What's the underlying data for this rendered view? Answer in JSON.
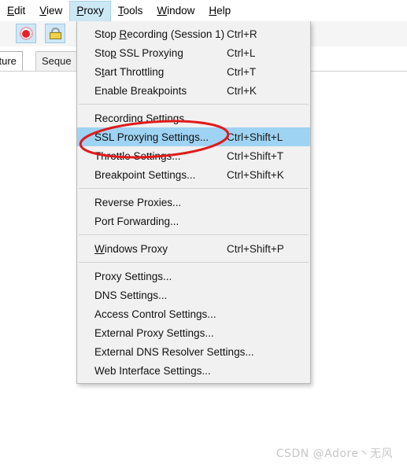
{
  "window": {
    "menubar": {
      "items": [
        {
          "label": "Edit",
          "mnemonic": "E",
          "active": false
        },
        {
          "label": "View",
          "mnemonic": "V",
          "active": false
        },
        {
          "label": "Proxy",
          "mnemonic": "P",
          "active": true
        },
        {
          "label": "Tools",
          "mnemonic": "T",
          "active": false
        },
        {
          "label": "Window",
          "mnemonic": "W",
          "active": false
        },
        {
          "label": "Help",
          "mnemonic": "H",
          "active": false
        }
      ]
    },
    "toolbar": {
      "buttons": [
        {
          "name": "record-button",
          "icon": "record-circle-icon",
          "pressed": true
        },
        {
          "name": "ssl-proxying-button",
          "icon": "padlock-icon",
          "pressed": true
        }
      ]
    },
    "tabs": [
      {
        "label": "cture",
        "full_label": "Structure",
        "selected": true
      },
      {
        "label": "Seque",
        "full_label": "Sequence",
        "selected": false
      }
    ]
  },
  "proxy_menu": {
    "title": "Proxy",
    "selected_item": "SSL Proxying Settings...",
    "highlight_color": "#9fd3f3",
    "items": [
      {
        "type": "item",
        "label": "Stop Recording (Session 1)",
        "mnemonic": "R",
        "accel": "Ctrl+R"
      },
      {
        "type": "item",
        "label": "Stop SSL Proxying",
        "mnemonic": "p",
        "accel": "Ctrl+L"
      },
      {
        "type": "item",
        "label": "Start Throttling",
        "mnemonic": "t",
        "accel": "Ctrl+T"
      },
      {
        "type": "item",
        "label": "Enable Breakpoints",
        "mnemonic": "",
        "accel": "Ctrl+K"
      },
      {
        "type": "separator"
      },
      {
        "type": "item",
        "label": "Recording Settings...",
        "mnemonic": "",
        "accel": ""
      },
      {
        "type": "item",
        "label": "SSL Proxying Settings...",
        "mnemonic": "",
        "accel": "Ctrl+Shift+L",
        "selected": true
      },
      {
        "type": "item",
        "label": "Throttle Settings...",
        "mnemonic": "",
        "accel": "Ctrl+Shift+T"
      },
      {
        "type": "item",
        "label": "Breakpoint Settings...",
        "mnemonic": "",
        "accel": "Ctrl+Shift+K"
      },
      {
        "type": "separator"
      },
      {
        "type": "item",
        "label": "Reverse Proxies...",
        "mnemonic": "",
        "accel": ""
      },
      {
        "type": "item",
        "label": "Port Forwarding...",
        "mnemonic": "",
        "accel": ""
      },
      {
        "type": "separator"
      },
      {
        "type": "item",
        "label": "Windows Proxy",
        "mnemonic": "W",
        "accel": "Ctrl+Shift+P"
      },
      {
        "type": "separator"
      },
      {
        "type": "item",
        "label": "Proxy Settings...",
        "mnemonic": "",
        "accel": ""
      },
      {
        "type": "item",
        "label": "DNS Settings...",
        "mnemonic": "",
        "accel": ""
      },
      {
        "type": "item",
        "label": "Access Control Settings...",
        "mnemonic": "",
        "accel": ""
      },
      {
        "type": "item",
        "label": "External Proxy Settings...",
        "mnemonic": "",
        "accel": ""
      },
      {
        "type": "item",
        "label": "External DNS Resolver Settings...",
        "mnemonic": "",
        "accel": ""
      },
      {
        "type": "item",
        "label": "Web Interface Settings...",
        "mnemonic": "",
        "accel": ""
      }
    ]
  },
  "annotation": {
    "shape": "ellipse",
    "color": "#e01b1b",
    "target": "SSL Proxying Settings..."
  },
  "watermark": {
    "text": "CSDN @Adore丶无风",
    "color": "#c7c7c7"
  }
}
